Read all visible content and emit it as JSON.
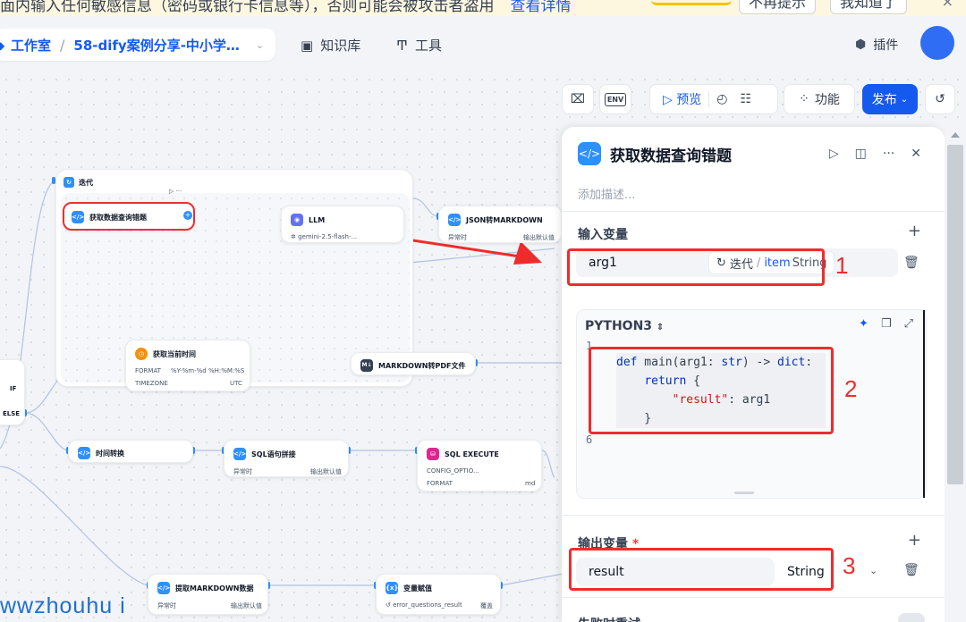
{
  "notice": {
    "text": "面内输入任何敏感信息（密码或银行卡信息等），否则可能会被攻击者盗用",
    "link": "查看详情",
    "btn_no_remind": "不再提示",
    "btn_ok": "我知道了",
    "close": "×"
  },
  "header": {
    "studio": "工作室",
    "app_name": "58-dify案例分享-中小学…",
    "nav": [
      "知识库",
      "工具"
    ],
    "plugin": "插件"
  },
  "toolbar": {
    "preview": "预览",
    "features": "功能",
    "publish": "发布",
    "env": "ENV"
  },
  "canvas": {
    "iteration_title": "迭代",
    "nodes": {
      "fetch_error": "获取数据查询错题",
      "llm": "LLM",
      "llm_model": "gemini-2.5-flash-...",
      "json_md": "JSON转MARKDOWN",
      "json_row_left": "异常时",
      "json_row_right": "输出默认值",
      "current_time": "获取当前时间",
      "format_label": "FORMAT",
      "format_value": "%Y-%m-%d %H:%M:%S",
      "timezone_label": "TIMEZONE",
      "timezone_value": "UTC",
      "md_pdf": "MARKDOWN转PDF文件",
      "if": "IF",
      "else": "ELSE",
      "time_convert": "时间转换",
      "sql_concat": "SQL语句拼接",
      "sql_row_left": "异常时",
      "sql_row_right": "输出默认值",
      "sql_execute": "SQL EXECUTE",
      "config_option": "CONFIG_OPTIO...",
      "format2_label": "FORMAT",
      "format2_value": "md",
      "extract_md": "提取MARKDOWN数据",
      "extract_row_left": "异常时",
      "extract_row_right": "输出默认值",
      "var_assign": "变量赋值",
      "var_row": "error_questions_result",
      "var_row_right": "覆盖"
    }
  },
  "panel": {
    "title": "获取数据查询错题",
    "desc_placeholder": "添加描述...",
    "input_section": "输入变量",
    "input_var": "arg1",
    "input_source": "迭代",
    "input_slash": "/",
    "input_item": "item",
    "input_type": "String",
    "code_lang": "PYTHON3",
    "output_section": "输出变量",
    "output_required": "*",
    "output_var": "result",
    "output_type": "String",
    "retry_section": "失败时重试"
  },
  "annotations": [
    "1",
    "2",
    "3"
  ],
  "watermark": "wwzhouhu i"
}
